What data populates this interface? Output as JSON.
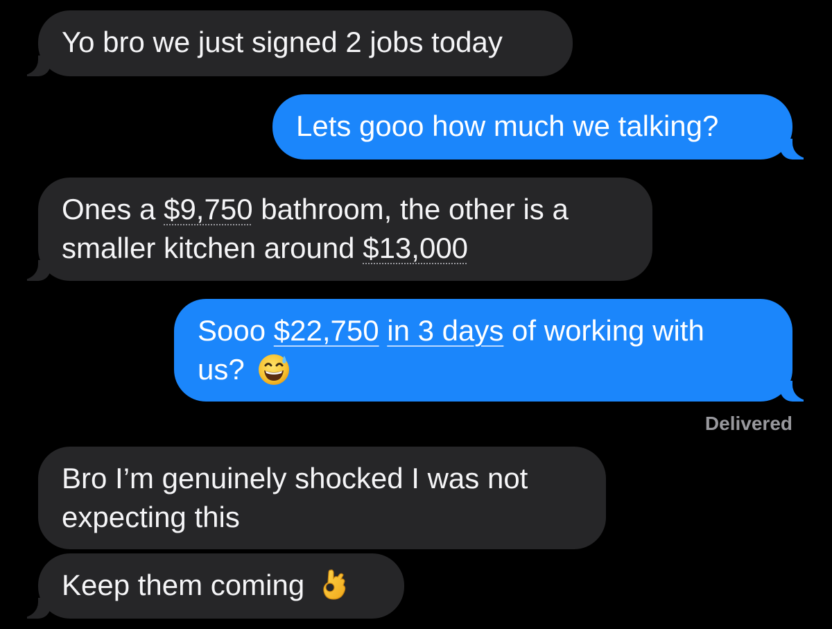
{
  "conversation": {
    "messages": [
      {
        "direction": "incoming",
        "text": "Yo bro we just signed 2 jobs today"
      },
      {
        "direction": "outgoing",
        "text": "Lets gooo how much we talking?"
      },
      {
        "direction": "incoming",
        "line1_prefix": "Ones a ",
        "line1_link": "$9,750",
        "line1_suffix": " bathroom, the other is a",
        "line2_prefix": "smaller kitchen around ",
        "line2_link": "$13,000"
      },
      {
        "direction": "outgoing",
        "line1_prefix": "Sooo ",
        "line1_link1": "$22,750",
        "line1_link2": "in 3 days",
        "line1_suffix": " of working with",
        "line2_text": "us?",
        "emoji": "grinning-face-with-sweat-emoji"
      },
      {
        "direction": "incoming",
        "line1": "Bro I’m genuinely shocked I was not",
        "line2": "expecting this"
      },
      {
        "direction": "incoming",
        "text": "Keep them coming",
        "emoji": "ok-hand-emoji"
      }
    ],
    "delivery_status": "Delivered"
  },
  "colors": {
    "background": "#000000",
    "incoming_bubble": "#262628",
    "outgoing_bubble": "#1b86fb",
    "status_text": "#98989d"
  }
}
